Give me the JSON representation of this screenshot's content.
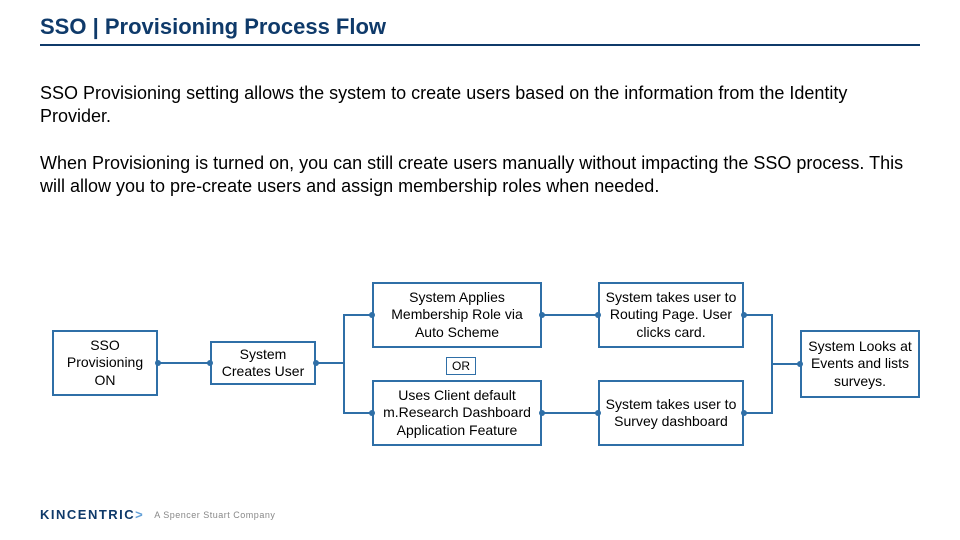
{
  "title": "SSO | Provisioning Process Flow",
  "intro": {
    "p1": "SSO Provisioning setting allows the system to create users based on the information from the Identity Provider.",
    "p2": "When Provisioning is turned on, you can still create users manually without impacting the SSO process. This will allow you to pre-create users and assign membership roles when needed."
  },
  "flow": {
    "box1": "SSO Provisioning ON",
    "box2": "System Creates User",
    "box3a": "System Applies Membership Role via Auto Scheme",
    "box3b": "Uses Client default m.Research Dashboard Application Feature",
    "or_label": "OR",
    "box4a": "System takes user to Routing Page. User clicks card.",
    "box4b": "System takes user to Survey dashboard",
    "box5": "System Looks at Events and lists surveys."
  },
  "footer": {
    "brand_main": "KINCENTRIC",
    "brand_accent": ">",
    "tagline": "A Spencer Stuart Company"
  }
}
